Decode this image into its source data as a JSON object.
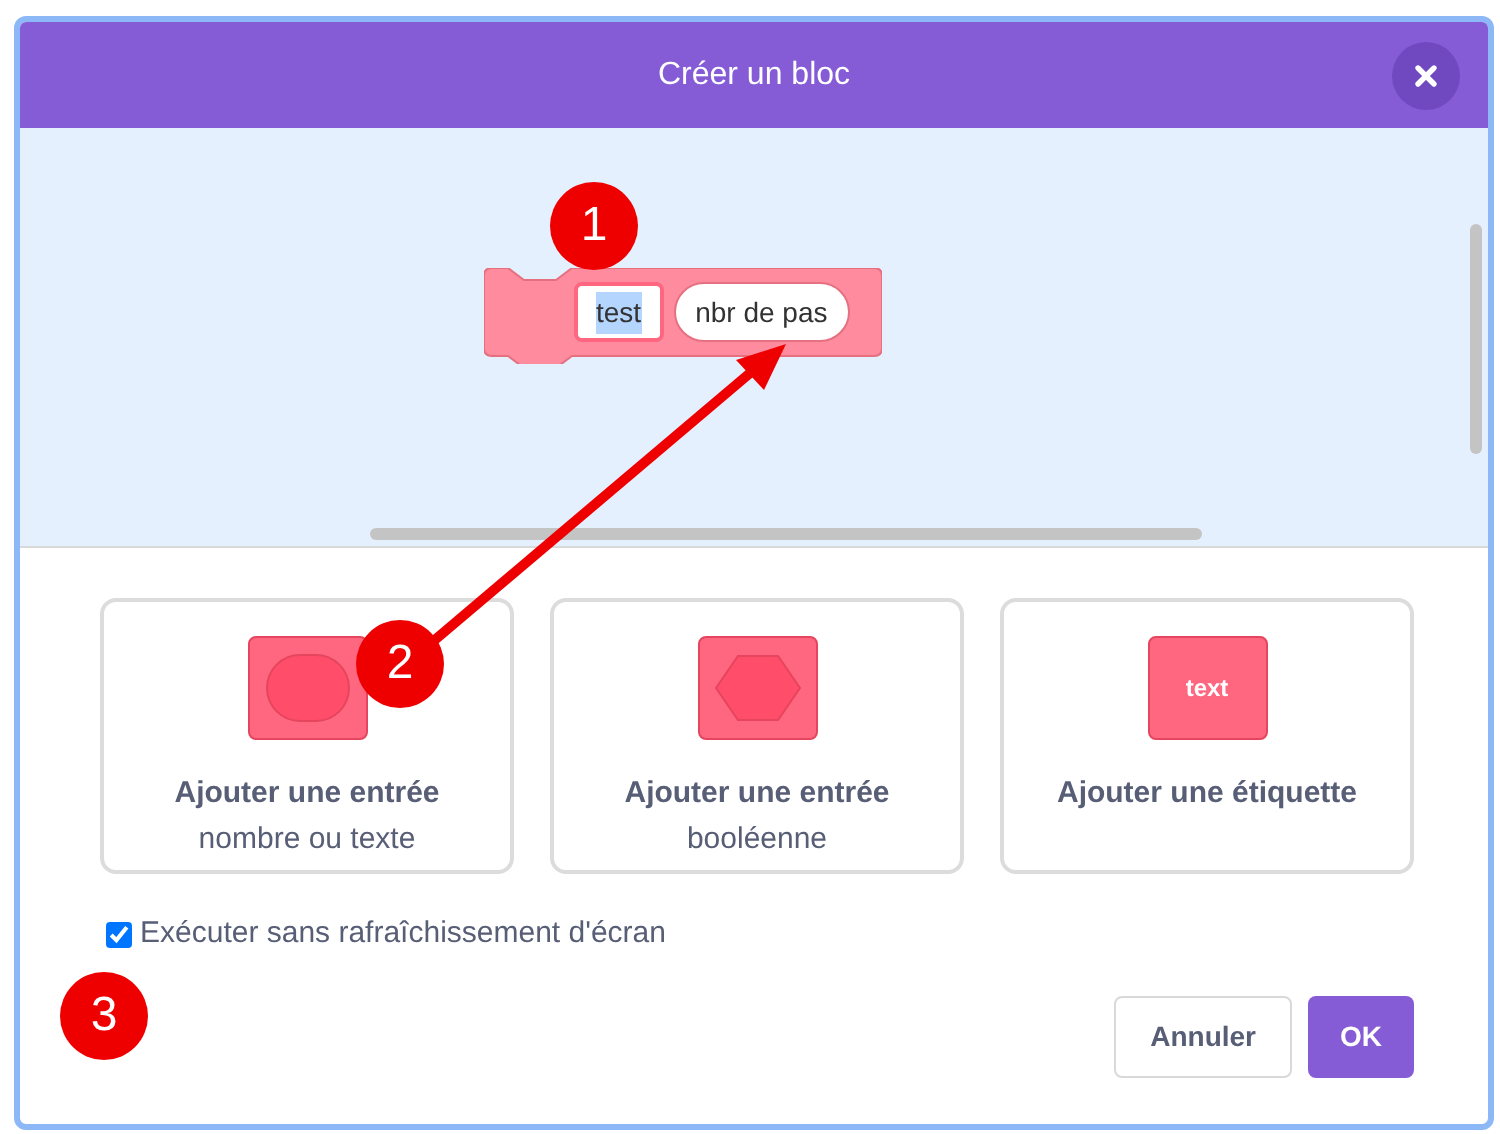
{
  "dialog": {
    "title": "Créer un bloc"
  },
  "block": {
    "label_text": "test",
    "label_selected": true,
    "input_name": "nbr de pas"
  },
  "options": [
    {
      "kind": "round",
      "title": "Ajouter une entrée",
      "subtitle": "nombre ou texte"
    },
    {
      "kind": "boolean",
      "title": "Ajouter une entrée",
      "subtitle": "booléenne"
    },
    {
      "kind": "label",
      "title": "Ajouter une étiquette",
      "icon_text": "text"
    }
  ],
  "checkbox": {
    "label": "Exécuter sans rafraîchissement d'écran",
    "checked": true
  },
  "buttons": [
    {
      "label": "Annuler",
      "kind": "secondary"
    },
    {
      "label": "OK",
      "kind": "primary"
    }
  ],
  "annotations": [
    {
      "label": "1"
    },
    {
      "label": "2"
    },
    {
      "label": "3"
    }
  ]
}
